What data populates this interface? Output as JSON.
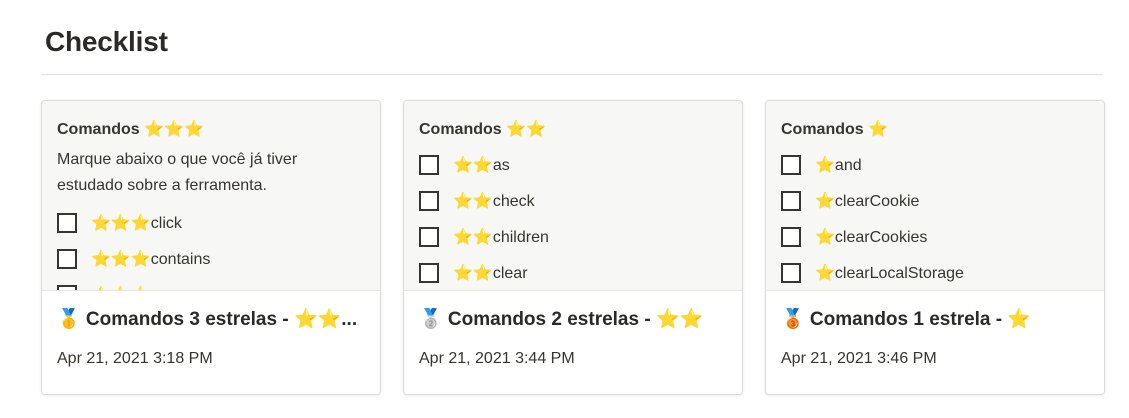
{
  "page": {
    "title": "Checklist"
  },
  "cards": [
    {
      "preview_title": "Comandos ⭐⭐⭐",
      "preview_desc": "Marque abaixo o que você já tiver estudado sobre a ferramenta.",
      "items": [
        "⭐⭐⭐click",
        "⭐⭐⭐contains",
        "⭐⭐⭐"
      ],
      "name": "🥇 Comandos 3 estrelas - ⭐⭐...",
      "date": "Apr 21, 2021 3:18 PM"
    },
    {
      "preview_title": "Comandos ⭐⭐",
      "items": [
        "⭐⭐as",
        "⭐⭐check",
        "⭐⭐children",
        "⭐⭐clear"
      ],
      "name": "🥈 Comandos 2 estrelas - ⭐⭐",
      "date": "Apr 21, 2021 3:44 PM"
    },
    {
      "preview_title": "Comandos ⭐",
      "items": [
        "⭐and",
        "⭐clearCookie",
        "⭐clearCookies",
        "⭐clearLocalStorage"
      ],
      "name": "🥉 Comandos 1 estrela - ⭐",
      "date": "Apr 21, 2021 3:46 PM"
    }
  ]
}
